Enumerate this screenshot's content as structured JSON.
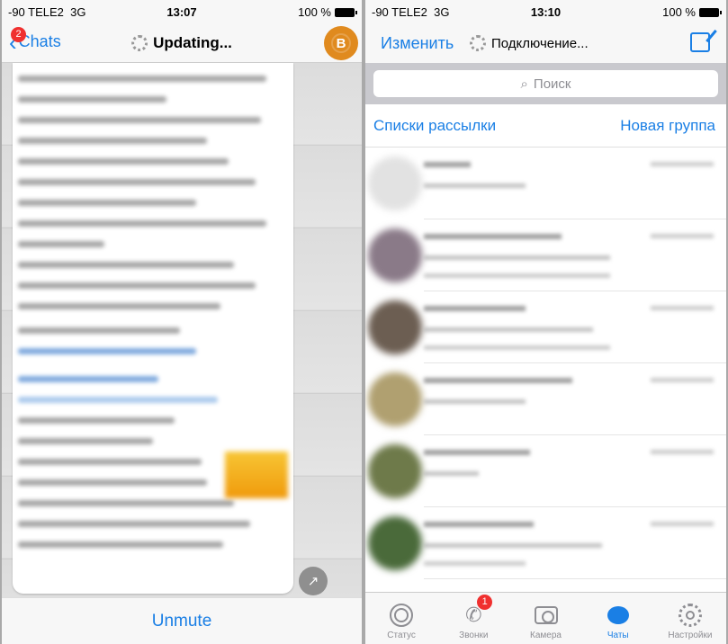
{
  "left": {
    "status": {
      "carrier": "-90 TELE2",
      "network": "3G",
      "time": "13:07",
      "battery": "100 %"
    },
    "nav": {
      "back_label": "Chats",
      "back_badge": "2",
      "title": "Updating...",
      "avatar_glyph": "B"
    },
    "footer": {
      "action_label": "Unmute"
    },
    "forward_icon": "↗"
  },
  "right": {
    "status": {
      "carrier": "-90 TELE2",
      "network": "3G",
      "time": "13:10",
      "battery": "100 %"
    },
    "nav": {
      "edit_label": "Изменить",
      "title": "Подключение..."
    },
    "search": {
      "placeholder": "Поиск"
    },
    "links": {
      "broadcast": "Списки рассылки",
      "new_group": "Новая группа"
    },
    "chats": [
      {
        "avatar_color": "#e2e2e2"
      },
      {
        "avatar_color": "#8a7a88"
      },
      {
        "avatar_color": "#6c5e52"
      },
      {
        "avatar_color": "#b0a070"
      },
      {
        "avatar_color": "#6e7a4a"
      },
      {
        "avatar_color": "#4a6a3a"
      }
    ],
    "tabs": [
      {
        "label": "Статус",
        "icon": "status-icon"
      },
      {
        "label": "Звонки",
        "icon": "phone-icon",
        "badge": "1"
      },
      {
        "label": "Камера",
        "icon": "camera-icon"
      },
      {
        "label": "Чаты",
        "icon": "chats-icon",
        "active": true
      },
      {
        "label": "Настройки",
        "icon": "settings-icon"
      }
    ]
  }
}
